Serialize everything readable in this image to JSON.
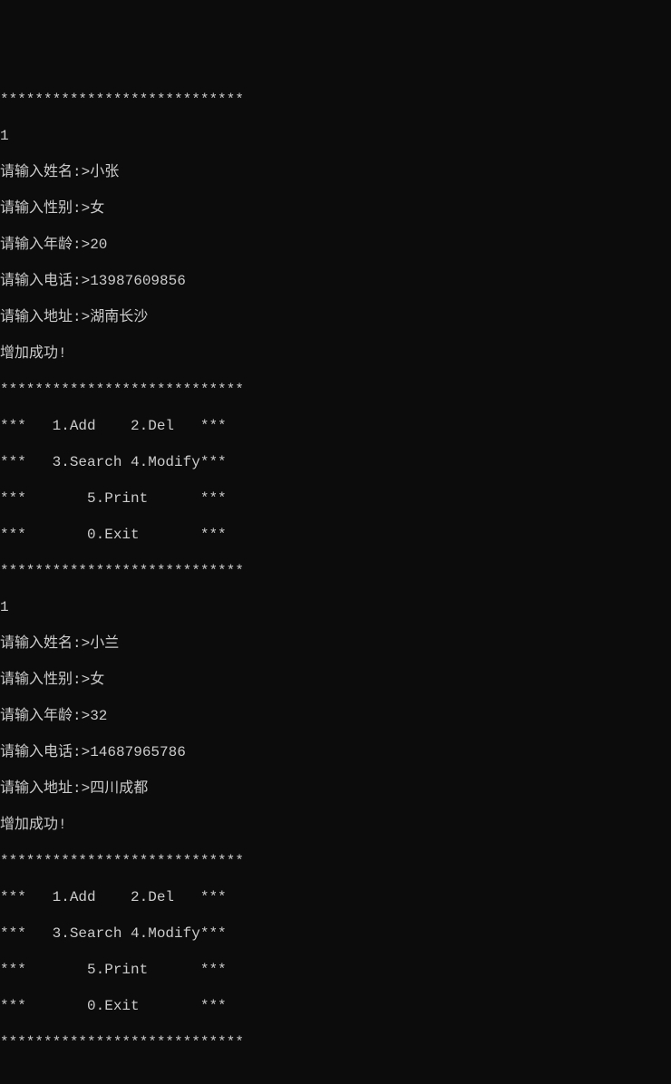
{
  "lines": [
    "****************************",
    "1",
    "请输入姓名:>小张",
    "请输入性别:>女",
    "请输入年龄:>20",
    "请输入电话:>13987609856",
    "请输入地址:>湖南长沙",
    "增加成功!",
    "****************************",
    "***   1.Add    2.Del   ***",
    "***   3.Search 4.Modify***",
    "***       5.Print      ***",
    "***       0.Exit       ***",
    "****************************",
    "1",
    "请输入姓名:>小兰",
    "请输入性别:>女",
    "请输入年龄:>32",
    "请输入电话:>14687965786",
    "请输入地址:>四川成都",
    "增加成功!",
    "****************************",
    "***   1.Add    2.Del   ***",
    "***   3.Search 4.Modify***",
    "***       5.Print      ***",
    "***       0.Exit       ***",
    "****************************",
    ""
  ],
  "entries": [
    {
      "menu_choice": "1",
      "name": "小张",
      "gender": "女",
      "age": "20",
      "phone": "13987609856",
      "address": "湖南长沙",
      "result": "增加成功!"
    },
    {
      "menu_choice": "1",
      "name": "小兰",
      "gender": "女",
      "age": "32",
      "phone": "14687965786",
      "address": "四川成都",
      "result": "增加成功!"
    }
  ],
  "menu": {
    "border": "****************************",
    "items": [
      {
        "num": "1",
        "label": "Add"
      },
      {
        "num": "2",
        "label": "Del"
      },
      {
        "num": "3",
        "label": "Search"
      },
      {
        "num": "4",
        "label": "Modify"
      },
      {
        "num": "5",
        "label": "Print"
      },
      {
        "num": "0",
        "label": "Exit"
      }
    ]
  },
  "prompts": {
    "name": "请输入姓名:>",
    "gender": "请输入性别:>",
    "age": "请输入年龄:>",
    "phone": "请输入电话:>",
    "address": "请输入地址:>"
  }
}
